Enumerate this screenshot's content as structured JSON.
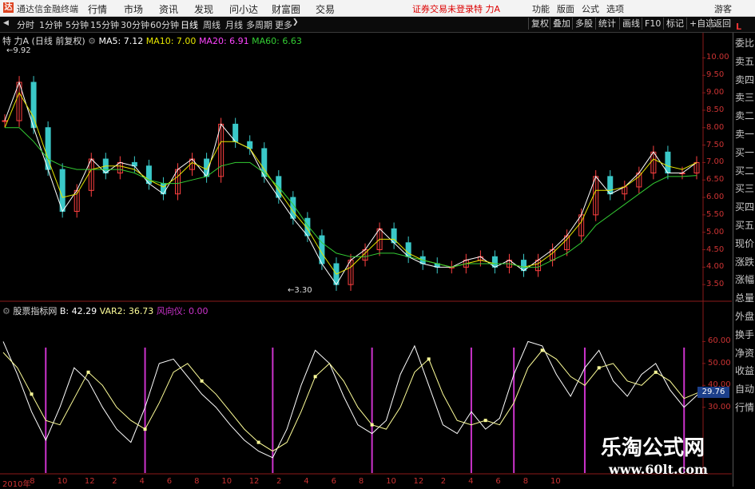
{
  "app": {
    "logo": "达",
    "name": "通达信金融终端",
    "menu": [
      "行情",
      "市场",
      "资讯",
      "发现",
      "问小达",
      "财富圈",
      "交易"
    ],
    "warning": "证券交易未登录",
    "stock_title": "特 力A",
    "right_menu": [
      "功能",
      "版面",
      "公式",
      "选项"
    ],
    "user": "游客"
  },
  "toolbar": {
    "periods": [
      "分时",
      "1分钟",
      "5分钟",
      "15分钟",
      "30分钟",
      "60分钟",
      "日线",
      "周线",
      "月线",
      "多周期",
      "更多"
    ],
    "active": "日线",
    "right_buttons": [
      "复权",
      "叠加",
      "多股",
      "统计",
      "画线",
      "F10",
      "标记",
      "+自选",
      "返回"
    ]
  },
  "right_panel": {
    "badge": "L",
    "items": [
      "委比",
      "卖五",
      "卖四",
      "卖三",
      "卖二",
      "卖一",
      "买一",
      "买二",
      "买三",
      "买四",
      "买五",
      "现价",
      "涨跌",
      "涨幅",
      "总量",
      "外盘",
      "换手",
      "净资",
      "收益",
      "自动",
      "行情"
    ]
  },
  "price_chart": {
    "header": {
      "name": "特 力A",
      "mode": "(日线 前复权)",
      "ma5": "MA5: 7.12",
      "ma10": "MA10: 7.00",
      "ma20": "MA20: 6.91",
      "ma60": "MA60: 6.63"
    },
    "high_label": "9.92",
    "low_label": "3.30",
    "colors": {
      "ma5": "#ffffff",
      "ma10": "#e6e600",
      "ma20": "#ff44ff",
      "ma60": "#33cc33"
    }
  },
  "indicator": {
    "header": {
      "name": "股票指标网",
      "b": "B: 42.29",
      "var2": "VAR2: 36.73",
      "risk": "风向仪: 0.00"
    },
    "current_value": "29.76",
    "colors": {
      "b": "#ffffff",
      "var2": "#ffff99",
      "risk": "#cc33cc"
    }
  },
  "chart_data": [
    {
      "type": "line",
      "title": "特 力A",
      "ylim": [
        3.0,
        10.4
      ],
      "yticks": [
        "10.00",
        "9.50",
        "9.00",
        "8.50",
        "8.00",
        "7.50",
        "7.00",
        "6.50",
        "6.00",
        "5.50",
        "5.00",
        "4.50",
        "4.00",
        "3.50"
      ],
      "series": [
        {
          "name": "MA5",
          "values": [
            8.2,
            9.3,
            8.0,
            6.8,
            5.6,
            6.2,
            7.1,
            6.7,
            7.0,
            6.9,
            6.4,
            6.1,
            6.8,
            7.1,
            6.6,
            8.1,
            7.6,
            7.4,
            6.6,
            6.0,
            5.4,
            4.9,
            4.1,
            3.5,
            4.2,
            4.5,
            5.1,
            4.7,
            4.3,
            4.1,
            4.0,
            4.0,
            4.2,
            4.3,
            4.0,
            4.2,
            3.9,
            4.2,
            4.5,
            4.9,
            5.5,
            6.6,
            6.1,
            6.3,
            6.7,
            7.3,
            6.7,
            6.7,
            7.0
          ]
        },
        {
          "name": "MA10",
          "values": [
            8.0,
            9.0,
            8.3,
            7.1,
            6.0,
            6.1,
            6.8,
            6.9,
            6.9,
            6.8,
            6.5,
            6.3,
            6.6,
            7.0,
            6.8,
            7.6,
            7.6,
            7.4,
            6.8,
            6.2,
            5.6,
            5.1,
            4.4,
            3.8,
            4.0,
            4.4,
            4.8,
            4.8,
            4.4,
            4.2,
            4.1,
            4.0,
            4.1,
            4.2,
            4.1,
            4.1,
            4.0,
            4.1,
            4.4,
            4.8,
            5.3,
            6.2,
            6.2,
            6.3,
            6.6,
            7.1,
            6.9,
            6.8,
            7.0
          ]
        },
        {
          "name": "MA60",
          "values": [
            8.0,
            8.0,
            7.6,
            7.1,
            6.9,
            6.8,
            6.8,
            6.8,
            6.8,
            6.7,
            6.5,
            6.4,
            6.4,
            6.5,
            6.6,
            6.9,
            7.0,
            7.0,
            6.7,
            6.3,
            5.8,
            5.2,
            4.7,
            4.4,
            4.3,
            4.3,
            4.4,
            4.4,
            4.3,
            4.2,
            4.1,
            4.0,
            4.1,
            4.1,
            4.1,
            4.1,
            4.0,
            4.0,
            4.2,
            4.4,
            4.7,
            5.2,
            5.5,
            5.8,
            6.1,
            6.4,
            6.6,
            6.6,
            6.63
          ]
        }
      ]
    },
    {
      "type": "line",
      "title": "股票指标网",
      "ylim": [
        0,
        70
      ],
      "yticks": [
        "60.00",
        "50.00",
        "40.00",
        "30.00"
      ],
      "series": [
        {
          "name": "B",
          "values": [
            60,
            45,
            28,
            15,
            30,
            48,
            42,
            30,
            20,
            14,
            30,
            50,
            52,
            44,
            36,
            30,
            22,
            15,
            10,
            7,
            20,
            40,
            56,
            50,
            35,
            22,
            18,
            24,
            45,
            58,
            40,
            22,
            18,
            28,
            20,
            25,
            45,
            60,
            58,
            45,
            35,
            48,
            56,
            42,
            35,
            45,
            50,
            38,
            30,
            36
          ]
        },
        {
          "name": "VAR2",
          "values": [
            55,
            48,
            36,
            24,
            22,
            34,
            46,
            40,
            30,
            24,
            20,
            32,
            46,
            50,
            42,
            36,
            28,
            20,
            14,
            10,
            14,
            28,
            44,
            50,
            42,
            30,
            22,
            20,
            30,
            46,
            52,
            36,
            24,
            22,
            24,
            22,
            32,
            48,
            56,
            52,
            44,
            40,
            48,
            50,
            42,
            40,
            46,
            42,
            34,
            36.7
          ]
        }
      ],
      "risk_spikes_x": [
        3,
        10,
        19,
        26,
        33,
        36,
        41,
        48
      ]
    }
  ],
  "x_axis": [
    "2010年",
    "8",
    "10",
    "12",
    "2",
    "4",
    "6",
    "8",
    "10",
    "12",
    "2",
    "4",
    "6",
    "8",
    "10",
    "12",
    "2",
    "4",
    "6",
    "8",
    "10"
  ],
  "watermark": {
    "line1": "乐淘公式网",
    "line2": "www.60lt.com"
  }
}
